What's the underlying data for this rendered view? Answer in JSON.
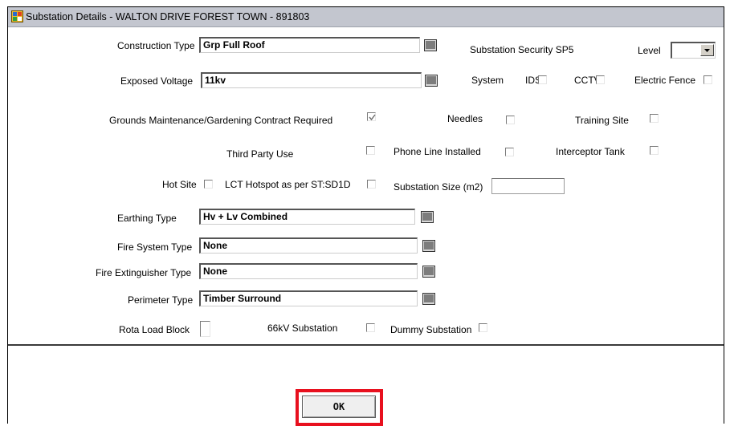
{
  "window": {
    "title": "Substation Details - WALTON DRIVE FOREST TOWN - 891803"
  },
  "construction": {
    "label": "Construction Type",
    "value": "Grp Full Roof"
  },
  "exposed_voltage": {
    "label": "Exposed Voltage",
    "value": "11kv"
  },
  "security": {
    "label": "Substation Security SP5",
    "level_label": "Level",
    "level_value": ""
  },
  "system": {
    "label": "System",
    "ids_label": "IDS",
    "cctv_label": "CCTV",
    "fence_label": "Electric Fence"
  },
  "grounds": {
    "label": "Grounds Maintenance/Gardening Contract Required",
    "checked": true
  },
  "needles": {
    "label": "Needles"
  },
  "training": {
    "label": "Training Site"
  },
  "third_party": {
    "label": "Third Party Use"
  },
  "phone_line": {
    "label": "Phone Line Installed"
  },
  "interceptor": {
    "label": "Interceptor Tank"
  },
  "hot_site": {
    "label": "Hot Site"
  },
  "lct": {
    "label": "LCT Hotspot as per ST:SD1D"
  },
  "size": {
    "label": "Substation Size (m2)",
    "value": ""
  },
  "earthing": {
    "label": "Earthing Type",
    "value": "Hv + Lv Combined"
  },
  "fire_system": {
    "label": "Fire System Type",
    "value": "None"
  },
  "fire_ext": {
    "label": "Fire Extinguisher Type",
    "value": "None"
  },
  "perimeter": {
    "label": "Perimeter Type",
    "value": "Timber Surround"
  },
  "rota": {
    "label": "Rota Load Block"
  },
  "kv66": {
    "label": "66kV Substation"
  },
  "dummy": {
    "label": "Dummy Substation"
  },
  "ok_button": {
    "label": "OK"
  },
  "colors": {
    "titlebar": "#c3c6cf",
    "highlight": "#e8101e"
  },
  "icons": {
    "app": "app-icon",
    "lov": "list-of-values-icon"
  }
}
